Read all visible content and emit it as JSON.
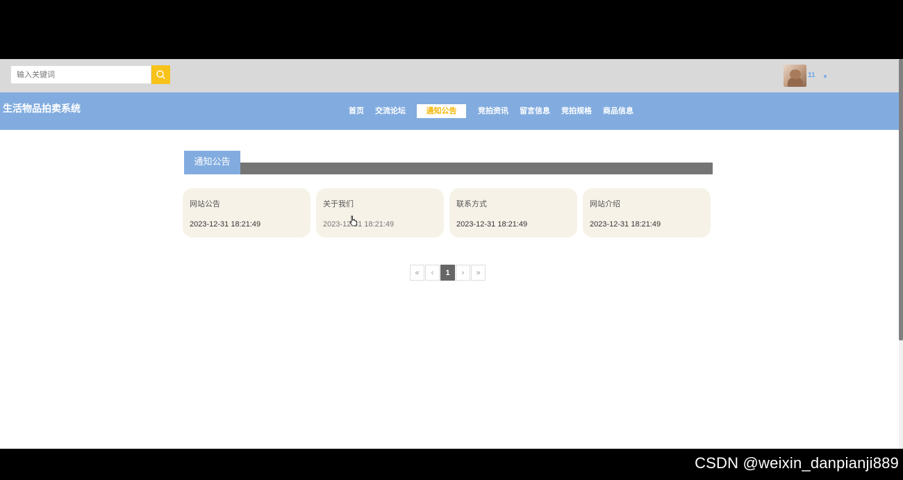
{
  "header": {
    "search": {
      "placeholder": "输入关键词",
      "value": ""
    },
    "search_icon": "search-icon",
    "user": {
      "name": "11",
      "menu_icon": "caret-down-icon"
    }
  },
  "nav": {
    "site_title": "生活物品拍卖系统",
    "items": [
      {
        "label": "首页"
      },
      {
        "label": "交流论坛"
      },
      {
        "label": "通知公告",
        "active": true
      },
      {
        "label": "竞拍资讯"
      },
      {
        "label": "留言信息"
      },
      {
        "label": "竞拍规格"
      },
      {
        "label": "商品信息"
      }
    ]
  },
  "section": {
    "title": "通知公告"
  },
  "cards": [
    {
      "title": "网站公告",
      "date": "2023-12-31 18:21:49"
    },
    {
      "title": "关于我们",
      "date": "2023-12-31 18:21:49"
    },
    {
      "title": "联系方式",
      "date": "2023-12-31 18:21:49"
    },
    {
      "title": "网站介绍",
      "date": "2023-12-31 18:21:49"
    }
  ],
  "pagination": {
    "first": "«",
    "prev": "‹",
    "current": "1",
    "next": "›",
    "last": "»"
  },
  "watermark": "CSDN @weixin_danpianji889",
  "colors": {
    "nav_bg": "#82acdf",
    "header_bg": "#d9d9d9",
    "accent": "#f7c21a",
    "active_text": "#f2b705",
    "card_bg": "#f7f2e8",
    "section_bar": "#757575"
  }
}
